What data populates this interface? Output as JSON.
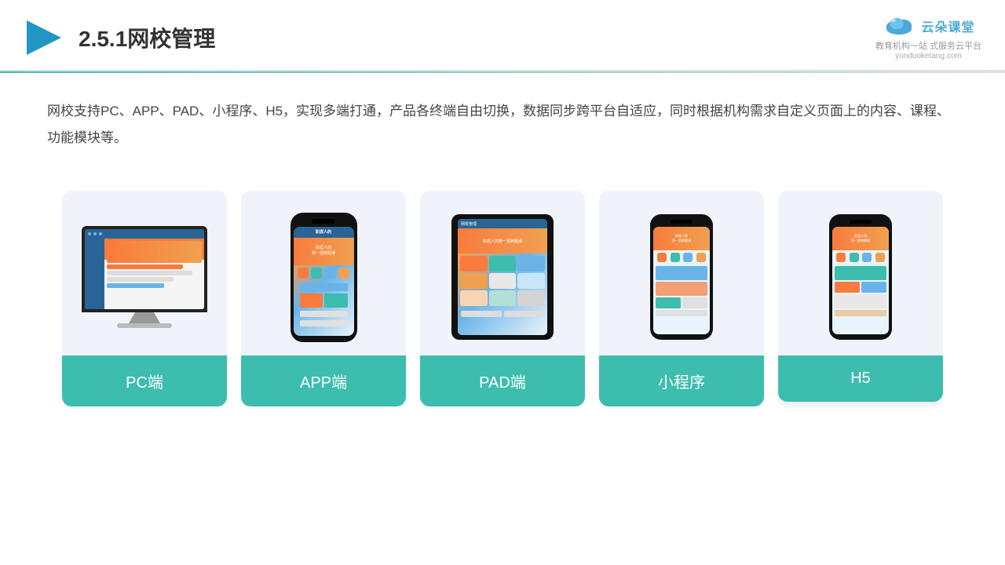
{
  "header": {
    "title": "2.5.1网校管理",
    "logo_text": "云朵课堂",
    "logo_url": "yunduoketang.com",
    "logo_sub": "教育机构一站\n式服务云平台"
  },
  "description": {
    "text": "网校支持PC、APP、PAD、小程序、H5，实现多端打通，产品各终端自由切换，数据同步跨平台自适应，同时根据机构需求自定义页面上的内容、课程、功能模块等。"
  },
  "cards": [
    {
      "id": "pc",
      "label": "PC端"
    },
    {
      "id": "app",
      "label": "APP端"
    },
    {
      "id": "pad",
      "label": "PAD端"
    },
    {
      "id": "miniprogram",
      "label": "小程序"
    },
    {
      "id": "h5",
      "label": "H5"
    }
  ],
  "colors": {
    "accent": "#3dbdad",
    "blue": "#2a6496",
    "orange": "#f97b3d"
  }
}
